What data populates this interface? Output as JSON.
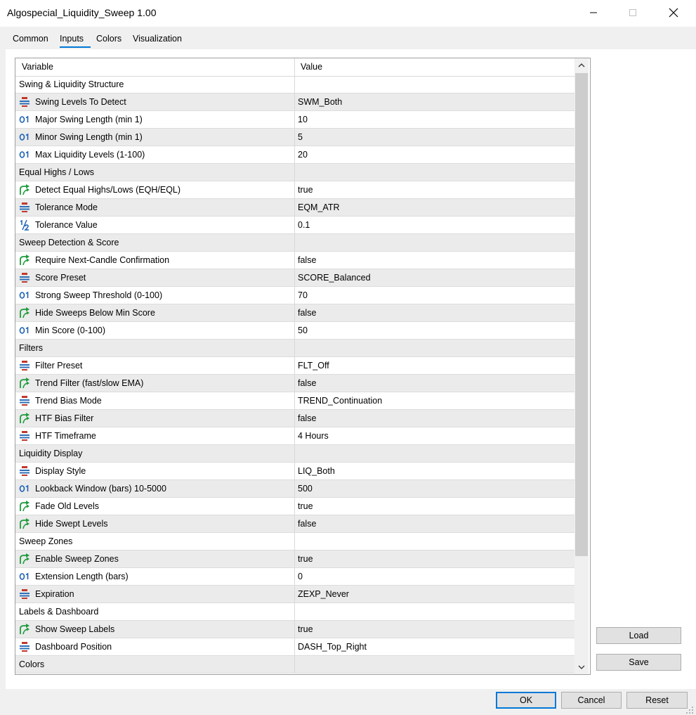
{
  "window": {
    "title": "Algospecial_Liquidity_Sweep 1.00"
  },
  "tabs": [
    {
      "label": "Common",
      "active": false
    },
    {
      "label": "Inputs",
      "active": true
    },
    {
      "label": "Colors",
      "active": false
    },
    {
      "label": "Visualization",
      "active": false
    }
  ],
  "grid": {
    "columns": [
      "Variable",
      "Value"
    ],
    "rows": [
      {
        "kind": "group",
        "label": "Swing & Liquidity Structure"
      },
      {
        "kind": "param",
        "icon": "enum-icon",
        "label": "Swing Levels To Detect",
        "value": "SWM_Both"
      },
      {
        "kind": "param",
        "icon": "integer-icon",
        "label": "Major Swing Length (min 1)",
        "value": "10"
      },
      {
        "kind": "param",
        "icon": "integer-icon",
        "label": "Minor Swing Length (min 1)",
        "value": "5"
      },
      {
        "kind": "param",
        "icon": "integer-icon",
        "label": "Max Liquidity Levels (1-100)",
        "value": "20"
      },
      {
        "kind": "group",
        "label": "Equal Highs / Lows"
      },
      {
        "kind": "param",
        "icon": "bool-icon",
        "label": "Detect Equal Highs/Lows (EQH/EQL)",
        "value": "true"
      },
      {
        "kind": "param",
        "icon": "enum-icon",
        "label": "Tolerance Mode",
        "value": "EQM_ATR"
      },
      {
        "kind": "param",
        "icon": "double-icon",
        "label": "Tolerance Value",
        "value": "0.1"
      },
      {
        "kind": "group",
        "label": "Sweep Detection & Score"
      },
      {
        "kind": "param",
        "icon": "bool-icon",
        "label": "Require Next-Candle Confirmation",
        "value": "false"
      },
      {
        "kind": "param",
        "icon": "enum-icon",
        "label": "Score Preset",
        "value": "SCORE_Balanced"
      },
      {
        "kind": "param",
        "icon": "integer-icon",
        "label": "Strong Sweep Threshold (0-100)",
        "value": "70"
      },
      {
        "kind": "param",
        "icon": "bool-icon",
        "label": "Hide Sweeps Below Min Score",
        "value": "false"
      },
      {
        "kind": "param",
        "icon": "integer-icon",
        "label": "Min Score (0-100)",
        "value": "50"
      },
      {
        "kind": "group",
        "label": "Filters"
      },
      {
        "kind": "param",
        "icon": "enum-icon",
        "label": "Filter Preset",
        "value": "FLT_Off"
      },
      {
        "kind": "param",
        "icon": "bool-icon",
        "label": "Trend Filter (fast/slow EMA)",
        "value": "false"
      },
      {
        "kind": "param",
        "icon": "enum-icon",
        "label": "Trend Bias Mode",
        "value": "TREND_Continuation"
      },
      {
        "kind": "param",
        "icon": "bool-icon",
        "label": "HTF Bias Filter",
        "value": "false"
      },
      {
        "kind": "param",
        "icon": "enum-icon",
        "label": "HTF Timeframe",
        "value": "4 Hours"
      },
      {
        "kind": "group",
        "label": "Liquidity Display"
      },
      {
        "kind": "param",
        "icon": "enum-icon",
        "label": "Display Style",
        "value": "LIQ_Both"
      },
      {
        "kind": "param",
        "icon": "integer-icon",
        "label": "Lookback Window (bars) 10-5000",
        "value": "500"
      },
      {
        "kind": "param",
        "icon": "bool-icon",
        "label": "Fade Old Levels",
        "value": "true"
      },
      {
        "kind": "param",
        "icon": "bool-icon",
        "label": "Hide Swept Levels",
        "value": "false"
      },
      {
        "kind": "group",
        "label": "Sweep Zones"
      },
      {
        "kind": "param",
        "icon": "bool-icon",
        "label": "Enable Sweep Zones",
        "value": "true"
      },
      {
        "kind": "param",
        "icon": "integer-icon",
        "label": "Extension Length (bars)",
        "value": "0"
      },
      {
        "kind": "param",
        "icon": "enum-icon",
        "label": "Expiration",
        "value": "ZEXP_Never"
      },
      {
        "kind": "group",
        "label": "Labels & Dashboard"
      },
      {
        "kind": "param",
        "icon": "bool-icon",
        "label": "Show Sweep Labels",
        "value": "true"
      },
      {
        "kind": "param",
        "icon": "enum-icon",
        "label": "Dashboard Position",
        "value": "DASH_Top_Right"
      },
      {
        "kind": "group",
        "label": "Colors"
      }
    ]
  },
  "buttons": {
    "load": "Load",
    "save": "Save",
    "ok": "OK",
    "cancel": "Cancel",
    "reset": "Reset"
  },
  "colors": {
    "accent": "#0078d7",
    "bool_icon": "#1e9b3c",
    "integer_icon": "#1a5fb4",
    "enum_icon_red": "#c0392b",
    "enum_icon_blue": "#2c6fb7"
  }
}
